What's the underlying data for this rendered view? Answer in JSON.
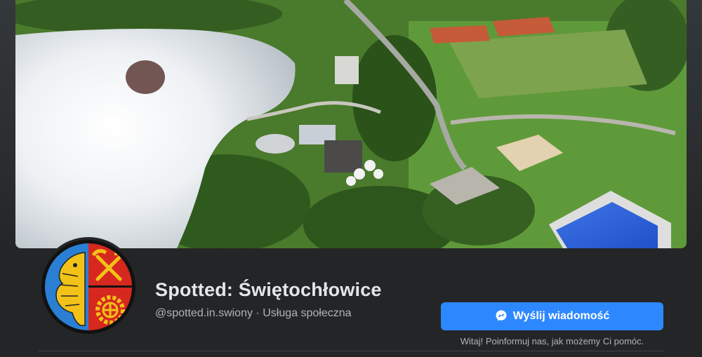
{
  "page": {
    "name": "Spotted: Świętochłowice",
    "handle": "@spotted.in.swiony",
    "separator": "·",
    "category": "Usługa społeczna"
  },
  "actions": {
    "message_button_label": "Wyślij wiadomość",
    "greeting": "Witaj! Poinformuj nas, jak możemy Ci pomóc."
  },
  "images": {
    "cover": "aerial photo of lake, park, sports fields and swimming pool",
    "avatar": "coat of arms: golden eagle on blue, hammer and pick with gear on red"
  },
  "icons": {
    "message": "messenger-icon"
  },
  "colors": {
    "background": "#18191a",
    "header_background": "#242526",
    "primary_button": "#2d88ff",
    "title_text": "#e4e6eb",
    "secondary_text": "#b0b3b8",
    "shield_blue": "#2a7fd4",
    "shield_red": "#d6281e",
    "shield_gold": "#f2c218"
  }
}
